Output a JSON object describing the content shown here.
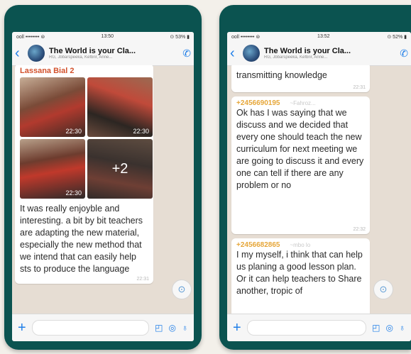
{
  "left": {
    "status": {
      "carrier": "ooll  ••••••••  ⊜",
      "time": "13:50",
      "battery": "⊙ 53% ▮"
    },
    "header": {
      "back": "‹",
      "title": "The World is your Cla...",
      "members": "RG, Jbbarspeeka, Kefbrir, Anne..."
    },
    "message": {
      "sender": "Lassana Bial 2",
      "photos": [
        {
          "time": "22:30"
        },
        {
          "time": "22:30"
        },
        {
          "time": "22:30"
        },
        {
          "overlay": "+2"
        }
      ],
      "text": "It was really enjoyble and interesting. a bit by bit teachers are adapting the new material, especially the new method that we intend that can easily help sts to produce the language",
      "time": "22:31"
    },
    "input": {
      "plus": "+",
      "sticker": "◰",
      "camera": "◎",
      "mic": "♁"
    }
  },
  "right": {
    "status": {
      "carrier": "ooll  ••••••••  ⊜",
      "time": "13:52",
      "battery": "⊙ 52% ▮"
    },
    "header": {
      "back": "‹",
      "title": "The World is your Cla...",
      "members": "RG, Jbbarspeeka, Kefbrir, Anne..."
    },
    "messages": [
      {
        "text": "transmitting knowledge",
        "time": "22:31"
      },
      {
        "sender": "+2456690195",
        "alias": "~Fahroz...",
        "text": "Ok has  I was saying that we discuss and we decided that every one should teach the new curriculum for next meeting we are going to discuss it and every one can tell if there are any problem or no",
        "time": "22:32"
      },
      {
        "sender": "+2456682865",
        "alias": "~mbo lo",
        "text": "I my myself, i think that can help us planing a good lesson plan. Or it can help teachers to Share another, tropic of"
      }
    ],
    "input": {
      "plus": "+",
      "sticker": "◰",
      "camera": "◎",
      "mic": "♁"
    }
  },
  "icons": {
    "scroll_down": "⊙",
    "add_call": "✆"
  }
}
